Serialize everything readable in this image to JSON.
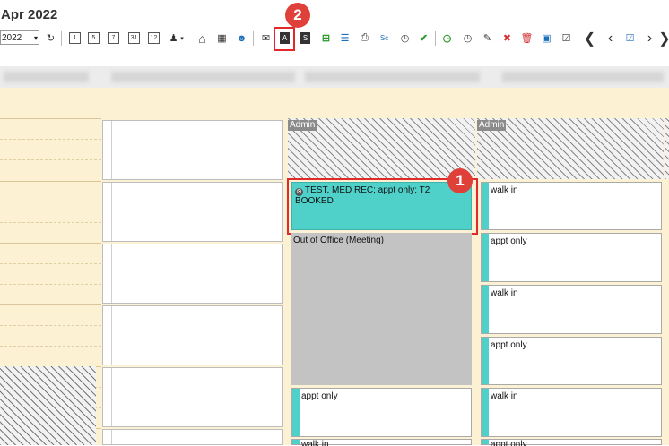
{
  "header": {
    "title": "Apr 2022"
  },
  "toolbar": {
    "year_value": "2022",
    "dropdown_glyph": "▾",
    "cal_labels": [
      "1",
      "5",
      "7",
      "31",
      "12"
    ],
    "letter_a": "A",
    "letter_s": "S",
    "icons": [
      "refresh-icon",
      "day-1-icon",
      "day-5-icon",
      "day-7-icon",
      "month-31-icon",
      "month-12-icon",
      "provider-icon",
      "home-icon",
      "grid-icon",
      "users-icon",
      "mail-icon",
      "a-icon",
      "s-icon",
      "add-icon",
      "document-icon",
      "print-icon",
      "sc-icon",
      "clock-icon",
      "clock-check-icon",
      "clock-add-icon",
      "clock-icon",
      "edit-icon",
      "clock-delete-icon",
      "trash-icon",
      "calendar-icon",
      "note-icon",
      "first-icon",
      "prev-icon",
      "calendar-check-icon",
      "next-icon",
      "last-icon"
    ]
  },
  "annotations": {
    "badge1": "1",
    "badge2": "2"
  },
  "schedule": {
    "column_headers": [
      "Admin",
      "Admin"
    ],
    "booked_appt": {
      "text": "TEST, MED REC; appt only; T2 BOOKED",
      "icon": "settings-circle-icon"
    },
    "out_of_office": "Out of Office (Meeting)",
    "col2_appts": [
      "appt only",
      "walk in"
    ],
    "col3_appts": [
      "walk in",
      "appt only",
      "walk in",
      "appt only",
      "walk in",
      "appt only"
    ]
  },
  "colors": {
    "schedule_bg": "#fdf1d3",
    "appt_teal": "#4fd1c9",
    "out_of_office": "#c3c3c3",
    "highlight_red": "#e02a2a"
  }
}
